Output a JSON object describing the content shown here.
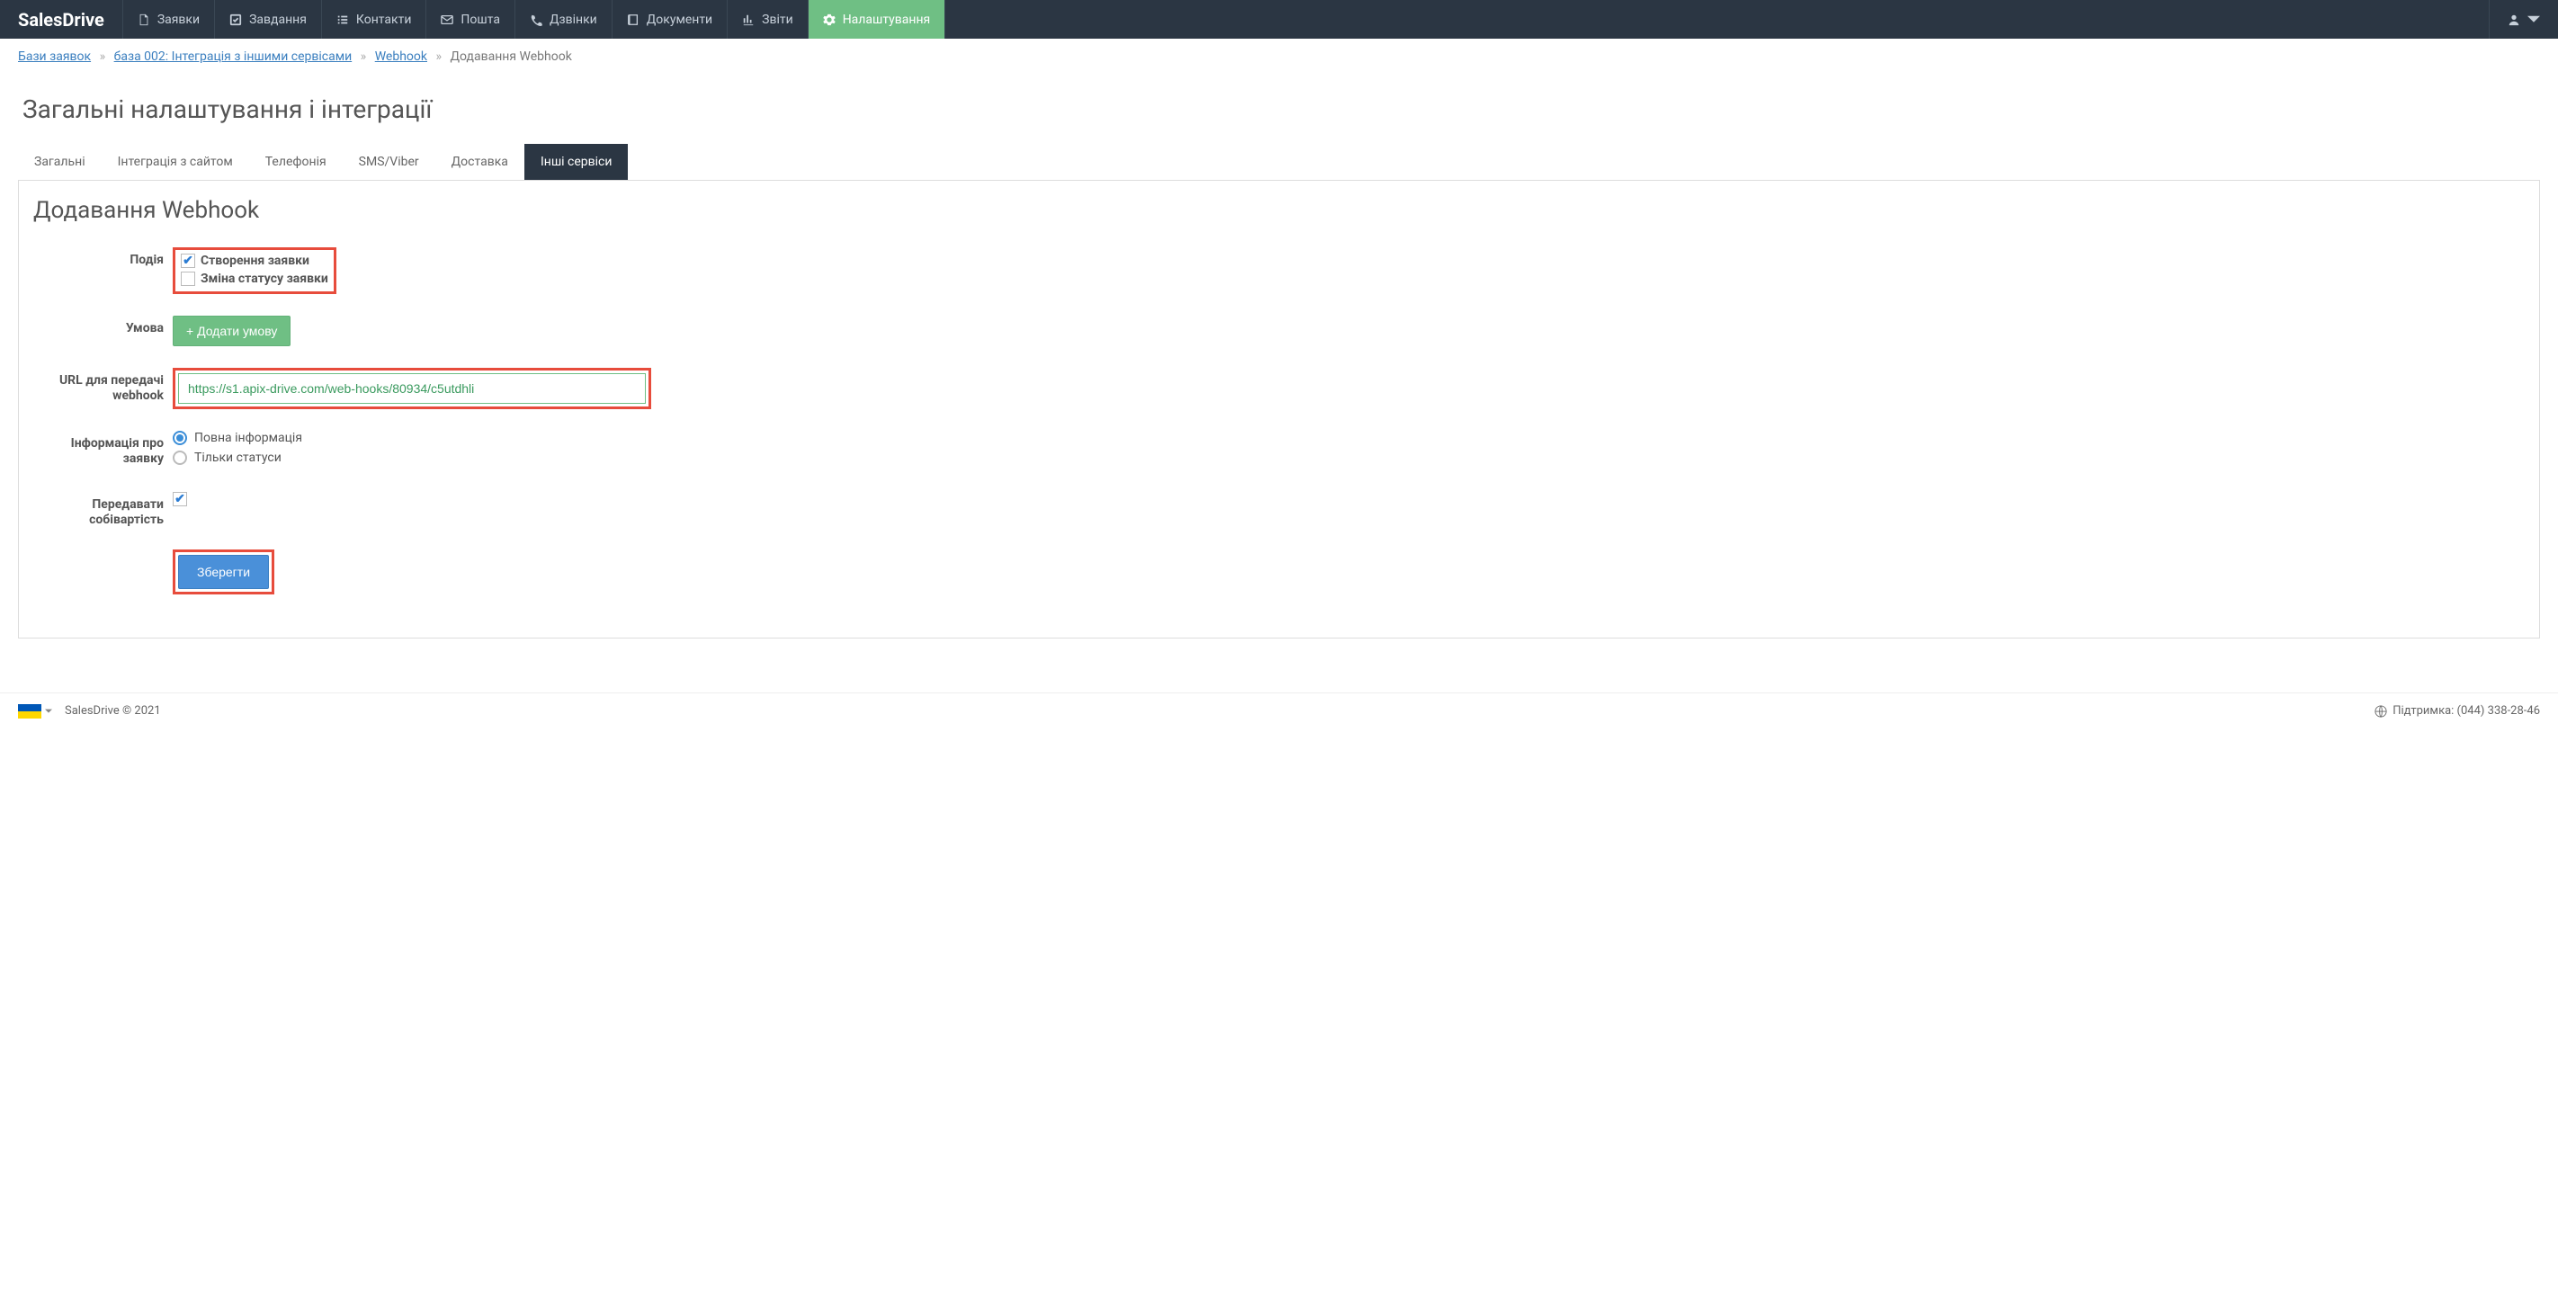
{
  "brand": "SalesDrive",
  "nav": {
    "items": [
      {
        "label": "Заявки"
      },
      {
        "label": "Завдання"
      },
      {
        "label": "Контакти"
      },
      {
        "label": "Пошта"
      },
      {
        "label": "Дзвінки"
      },
      {
        "label": "Документи"
      },
      {
        "label": "Звіти"
      },
      {
        "label": "Налаштування",
        "active": true
      }
    ]
  },
  "breadcrumb": {
    "items": [
      {
        "label": "Бази заявок",
        "link": true
      },
      {
        "label": "база 002: Інтеграція з іншими сервісами",
        "link": true
      },
      {
        "label": "Webhook",
        "link": true
      },
      {
        "label": "Додавання Webhook",
        "link": false
      }
    ],
    "sep": "»"
  },
  "pageTitle": "Загальні налаштування і інтеграції",
  "tabs": [
    {
      "label": "Загальні"
    },
    {
      "label": "Інтеграція з сайтом"
    },
    {
      "label": "Телефонія"
    },
    {
      "label": "SMS/Viber"
    },
    {
      "label": "Доставка"
    },
    {
      "label": "Інші сервіси",
      "active": true
    }
  ],
  "sectionTitle": "Додавання Webhook",
  "form": {
    "eventLabel": "Подія",
    "events": {
      "create": "Створення заявки",
      "status": "Зміна статусу заявки"
    },
    "conditionLabel": "Умова",
    "addCondition": "+ Додати умову",
    "urlLabel": "URL для передачі webhook",
    "urlValue": "https://s1.apix-drive.com/web-hooks/80934/c5utdhli",
    "infoLabel": "Інформація про заявку",
    "infoFull": "Повна інформація",
    "infoStatus": "Тільки статуси",
    "costLabel": "Передавати собівартість",
    "save": "Зберегти"
  },
  "footer": {
    "copyright": "SalesDrive © 2021",
    "support": "Підтримка: (044) 338-28-46"
  }
}
